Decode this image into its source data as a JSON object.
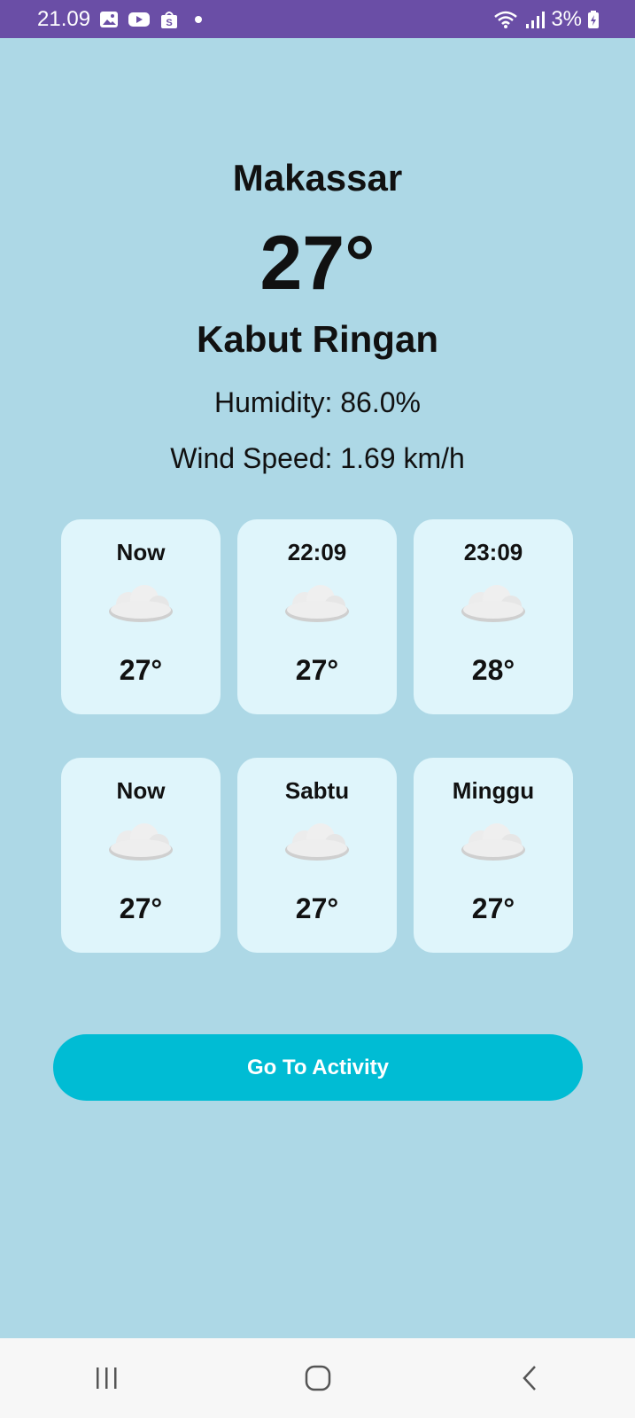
{
  "status_bar": {
    "time": "21.09",
    "battery": "3%",
    "icons": [
      "gallery-icon",
      "youtube-icon",
      "shopee-icon",
      "notification-dot",
      "wifi-icon",
      "signal-icon",
      "battery-charging-icon"
    ]
  },
  "weather": {
    "city": "Makassar",
    "temperature": "27°",
    "condition": "Kabut Ringan",
    "humidity": "Humidity: 86.0%",
    "wind_speed": "Wind Speed: 1.69 km/h"
  },
  "hourly": [
    {
      "label": "Now",
      "temp": "27°",
      "icon": "cloud-icon"
    },
    {
      "label": "22:09",
      "temp": "27°",
      "icon": "cloud-icon"
    },
    {
      "label": "23:09",
      "temp": "28°",
      "icon": "cloud-icon"
    }
  ],
  "daily": [
    {
      "label": "Now",
      "temp": "27°",
      "icon": "cloud-icon"
    },
    {
      "label": "Sabtu",
      "temp": "27°",
      "icon": "cloud-icon"
    },
    {
      "label": "Minggu",
      "temp": "27°",
      "icon": "cloud-icon"
    }
  ],
  "button": {
    "label": "Go To Activity"
  },
  "colors": {
    "background": "#add8e6",
    "status_bar": "#6a4ea6",
    "card": "#dff5fb",
    "button": "#00bcd4"
  },
  "nav": {
    "icons": [
      "recent-apps-icon",
      "home-icon",
      "back-icon"
    ]
  }
}
